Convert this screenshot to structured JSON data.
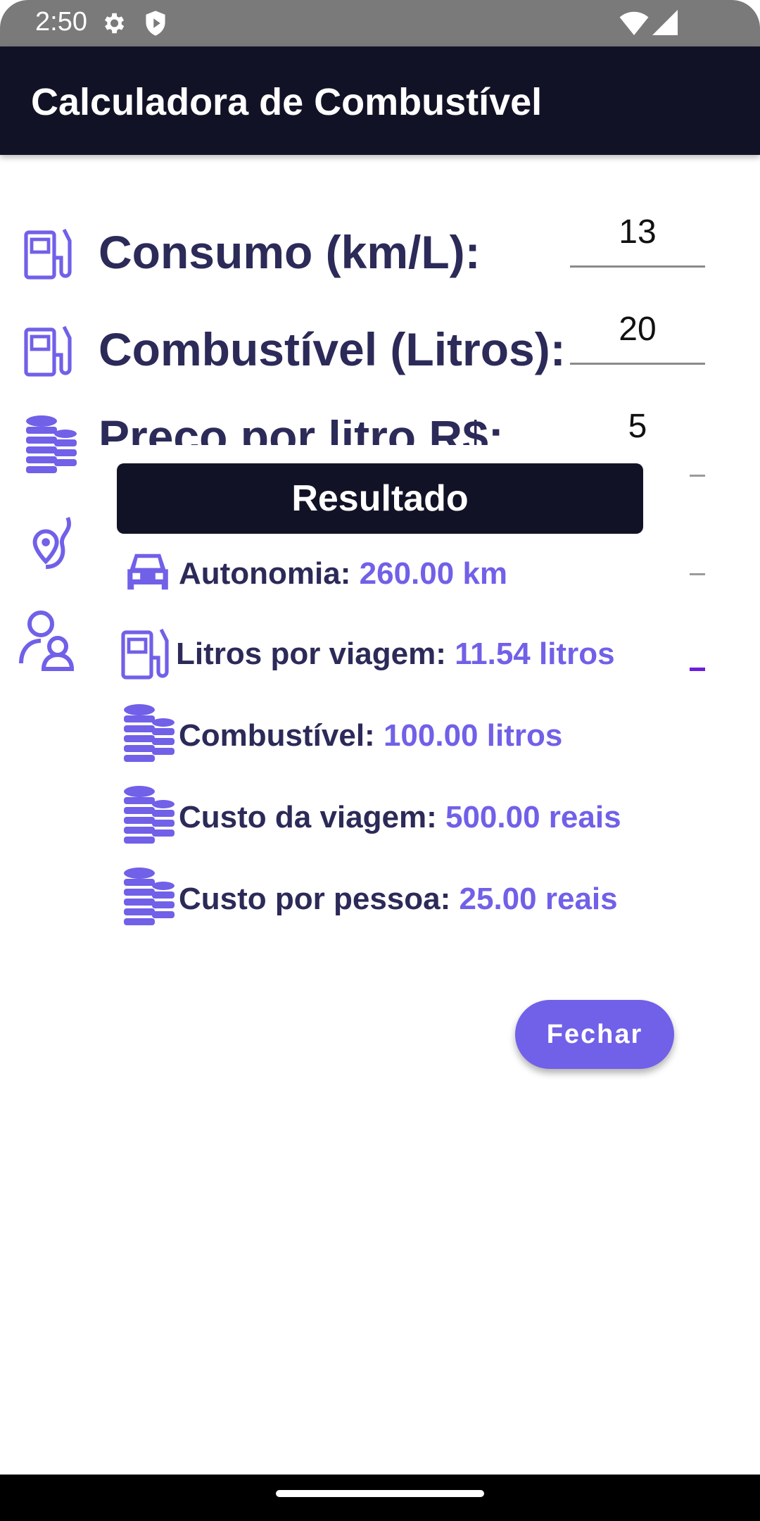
{
  "status_bar": {
    "time": "2:50"
  },
  "app_bar": {
    "title": "Calculadora de Combustível"
  },
  "form": {
    "rows": [
      {
        "label": "Consumo (km/L):",
        "value": "13"
      },
      {
        "label": "Combustível (Litros):",
        "value": "20"
      },
      {
        "label": "Preço por litro R$:",
        "value": "5"
      }
    ]
  },
  "dialog": {
    "title": "Resultado",
    "results": [
      {
        "label": "Autonomia:",
        "value": "260.00 km"
      },
      {
        "label": "Litros por viagem:",
        "value": "11.54 litros"
      },
      {
        "label": "Combustível:",
        "value": "100.00 litros"
      },
      {
        "label": "Custo da viagem:",
        "value": "500.00 reais"
      },
      {
        "label": "Custo por pessoa:",
        "value": "25.00 reais"
      }
    ],
    "close_label": "Fechar"
  },
  "colors": {
    "accent": "#7160e8",
    "header": "#121227",
    "label_text": "#2c2a58"
  }
}
